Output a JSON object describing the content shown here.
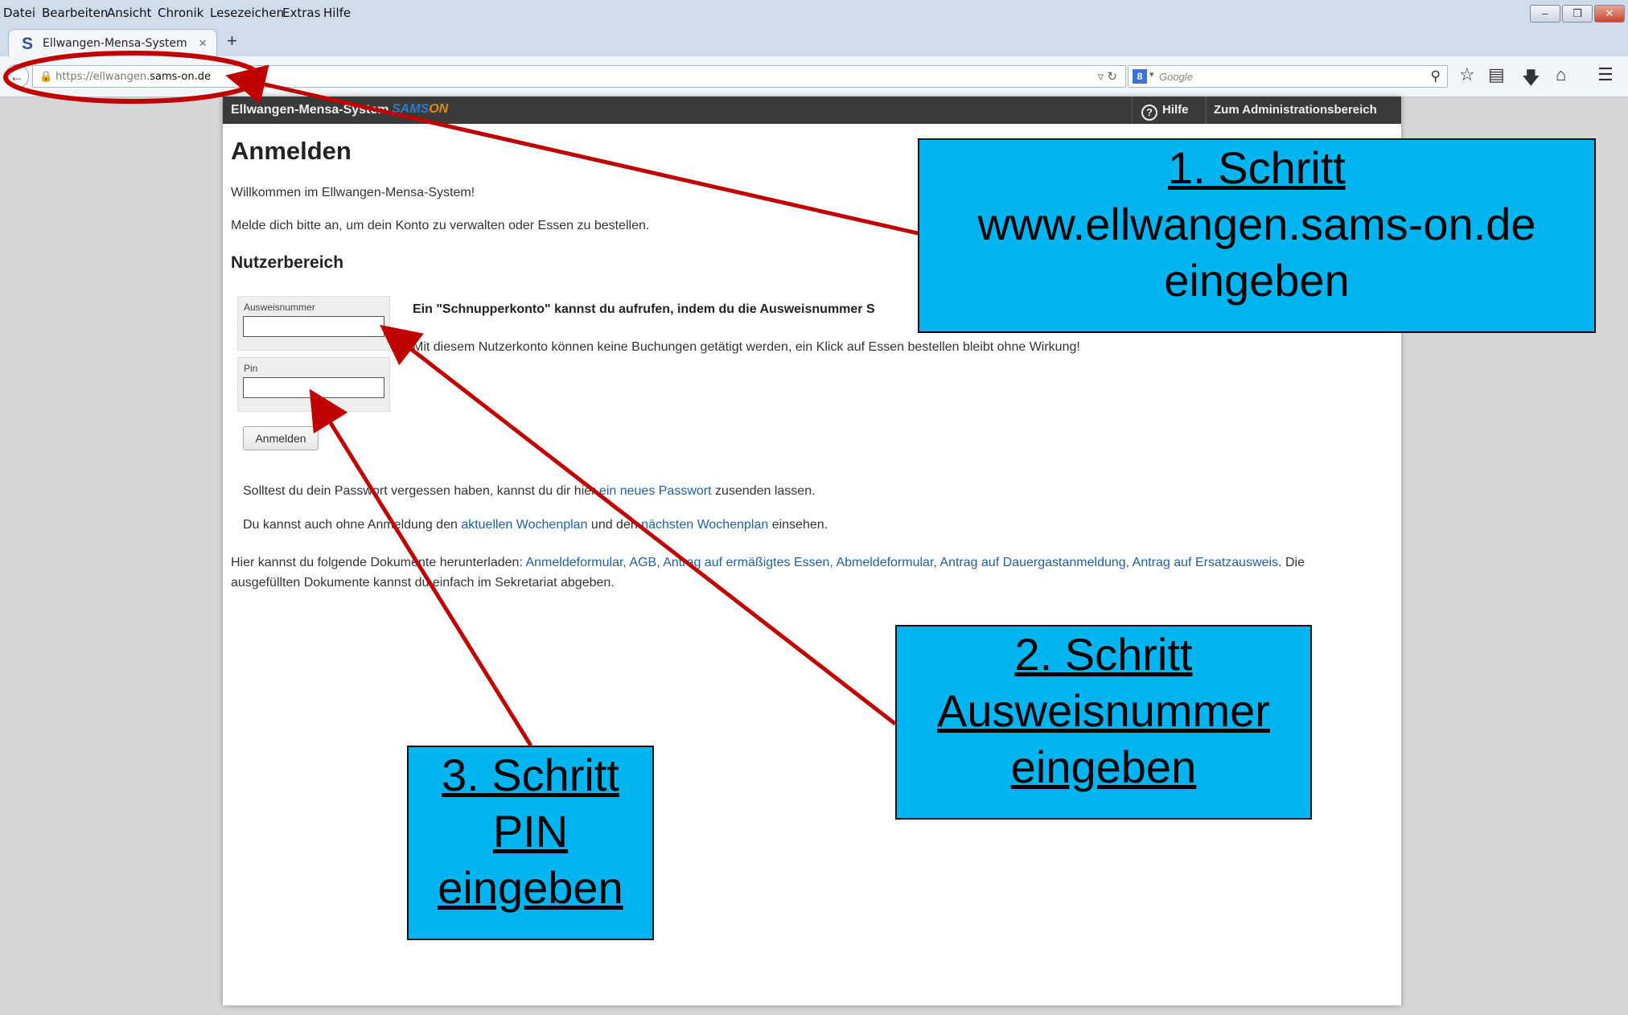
{
  "browser": {
    "menu": [
      "Datei",
      "Bearbeiten",
      "Ansicht",
      "Chronik",
      "Lesezeichen",
      "Extras",
      "Hilfe"
    ],
    "tab_title": "Ellwangen-Mensa-System",
    "tab_favicon": "S",
    "url_prefix": "https://ellwangen.",
    "url_domain": "sams-on.de",
    "search_placeholder": "Google"
  },
  "site": {
    "brand": "Ellwangen-Mensa-System",
    "logo_part1": "SAMS",
    "logo_part2": "ON",
    "help_label": "Hilfe",
    "admin_label": "Zum Administrationsbereich"
  },
  "login": {
    "title": "Anmelden",
    "welcome": "Willkommen im Ellwangen-Mensa-System!",
    "instruction": "Melde dich bitte an, um dein Konto zu verwalten oder Essen zu bestellen.",
    "section": "Nutzerbereich",
    "id_label": "Ausweisnummer",
    "pin_label": "Pin",
    "submit": "Anmelden",
    "trial_text": "Ein \"Schnupperkonto\" kannst du aufrufen, indem du die Ausweisnummer S",
    "trial_note": "Mit diesem Nutzerkonto können keine Buchungen getätigt werden, ein Klick auf Essen bestellen bleibt ohne Wirkung!",
    "forgot_pre": "Solltest du dein Passwort vergessen haben, kannst du dir hier ",
    "forgot_link": "ein neues Passwort",
    "forgot_post": " zusenden lassen.",
    "plan_pre": "Du kannst auch ohne Anmeldung den ",
    "plan_link1": "aktuellen Wochenplan",
    "plan_mid": " und den ",
    "plan_link2": "nächsten Wochenplan",
    "plan_post": " einsehen.",
    "docs_pre": "Hier kannst du folgende Dokumente herunterladen: ",
    "docs_links": "Anmeldeformular, AGB, Antrag auf ermäßigtes Essen, Abmeldeformular, Antrag auf Dauergastanmeldung, Antrag auf Ersatzausweis",
    "docs_post": ". Die",
    "docs_line2": "ausgefüllten Dokumente kannst du einfach im Sekretariat abgeben."
  },
  "annotations": {
    "step1": [
      "1. Schritt",
      "www.ellwangen.sams-on.de",
      "eingeben"
    ],
    "step2": [
      "2. Schritt",
      "Ausweisnummer",
      "eingeben"
    ],
    "step3": [
      "3. Schritt",
      "PIN",
      "eingeben"
    ],
    "arrow_color": "#c00000",
    "box_color": "#00b4f0"
  }
}
